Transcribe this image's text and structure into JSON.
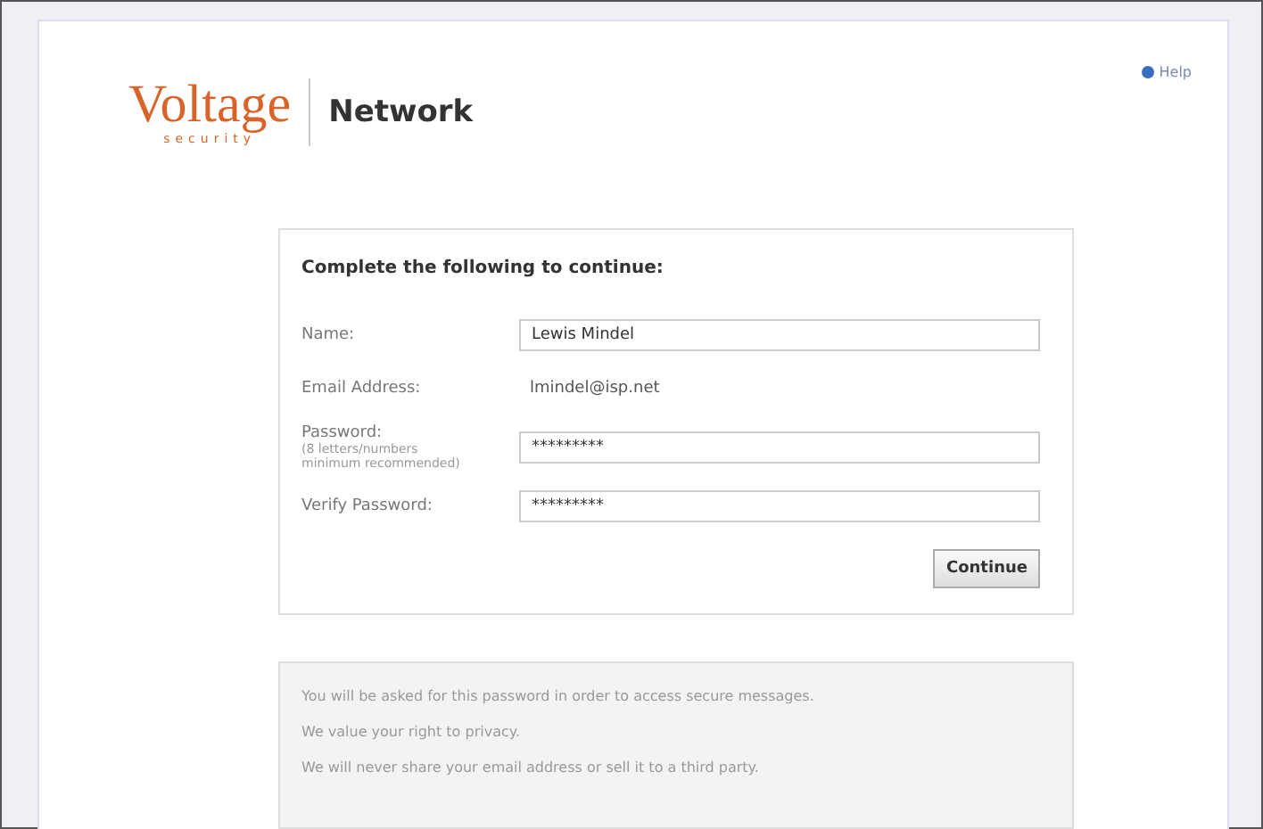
{
  "logo": {
    "name": "Voltage",
    "tagline": "security",
    "product": "Network"
  },
  "help_link": "Help",
  "form": {
    "heading": "Complete the following to continue:",
    "fields": [
      {
        "kind": "input",
        "label": "Name:",
        "value": "Lewis Mindel"
      },
      {
        "kind": "static",
        "label": "Email Address:",
        "value": "lmindel@isp.net"
      },
      {
        "kind": "password",
        "label": "Password:",
        "hint": "(8 letters/numbers minimum recommended)",
        "value": "*********"
      },
      {
        "kind": "password",
        "label": "Verify Password:",
        "value": "*********"
      }
    ],
    "button": "Continue"
  },
  "notes": [
    "You will be asked for this password in order to access secure messages.",
    "We value your right to privacy.",
    "We will never share your email address or sell it to a third party."
  ]
}
